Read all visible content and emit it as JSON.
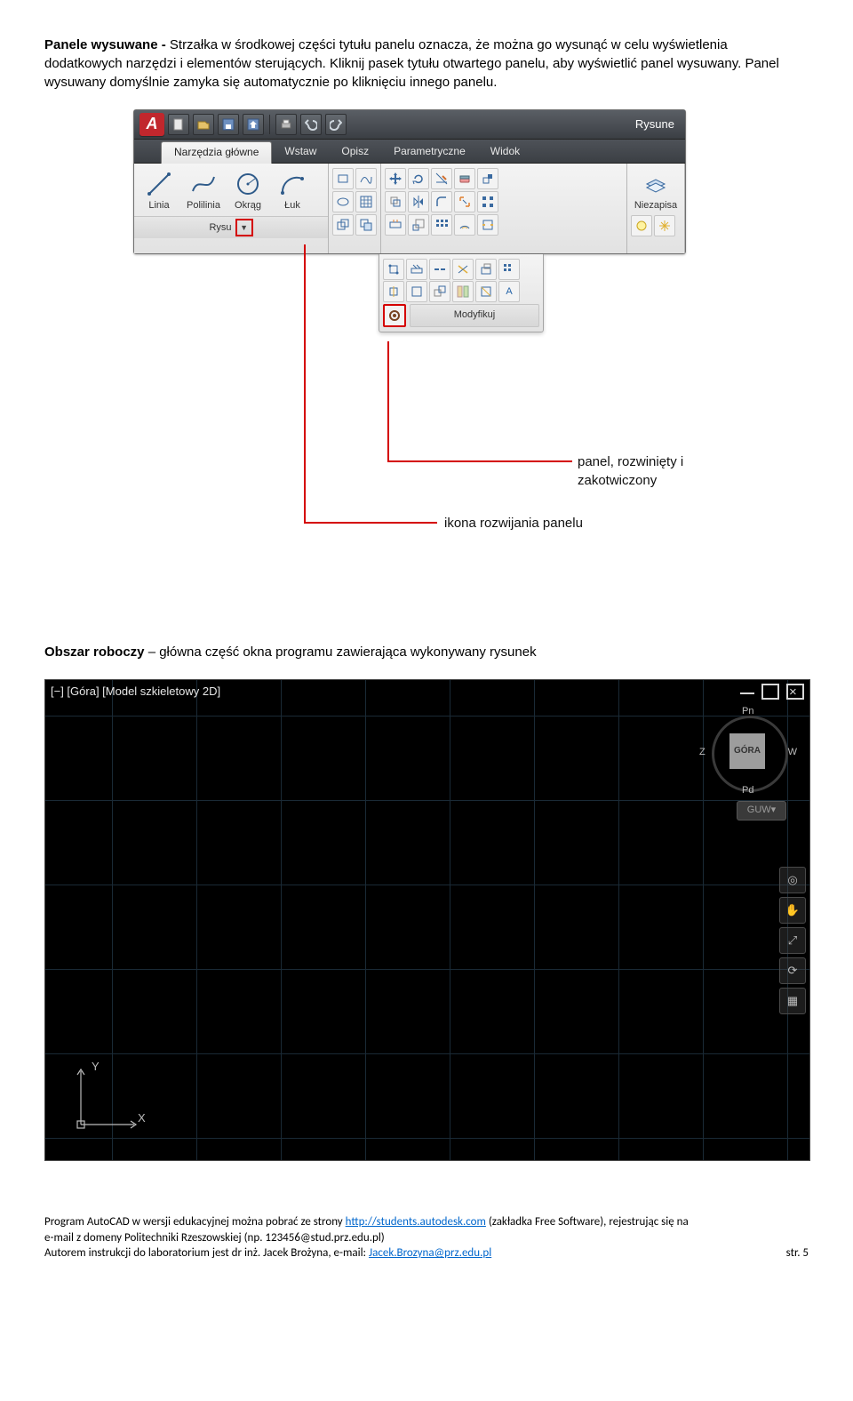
{
  "para1": {
    "lead": "Panele wysuwane - ",
    "text": "Strzałka w środkowej części tytułu panelu oznacza, że można go wysunąć w celu wyświetlenia dodatkowych narzędzi i elementów sterujących. Kliknij pasek tytułu otwartego panelu, aby wyświetlić panel wysuwany. Panel wysuwany domyślnie zamyka się automatycznie po kliknięciu innego panelu."
  },
  "ribbon": {
    "doc_title": "Rysune",
    "tabs": [
      "Narzędzia główne",
      "Wstaw",
      "Opisz",
      "Parametryczne",
      "Widok"
    ],
    "draw_btns": [
      "Linia",
      "Polilinia",
      "Okrąg",
      "Łuk"
    ],
    "draw_panel_title": "Rysu",
    "modify_panel_title": "Modyfikuj",
    "layer_label": "Niezapisa"
  },
  "callouts": {
    "panel": "panel, rozwinięty i zakotwiczony",
    "icon": "ikona rozwijania panelu"
  },
  "para2": {
    "lead": "Obszar roboczy",
    "text": " – główna część okna programu zawierająca wykonywany rysunek"
  },
  "drawing": {
    "viewport_label": "[−] [Góra] [Model szkieletowy 2D]",
    "cube": {
      "face": "GÓRA",
      "n": "Pn",
      "s": "Pd",
      "w": "Z",
      "e": "W"
    },
    "guw": "GUW",
    "axes": {
      "y": "Y",
      "x": "X"
    }
  },
  "footer": {
    "l1a": "Program AutoCAD w wersji edukacyjnej można pobrać ze strony ",
    "l1link": "http://students.autodesk.com",
    "l1b": " (zakładka Free Software), rejestrując się na",
    "l2": "e-mail z domeny Politechniki Rzeszowskiej (np. 123456@stud.prz.edu.pl)",
    "l3a": "Autorem instrukcji do laboratorium jest dr inż. Jacek Brożyna, e-mail: ",
    "l3link": "Jacek.Brozyna@prz.edu.pl",
    "page": "str. 5"
  }
}
